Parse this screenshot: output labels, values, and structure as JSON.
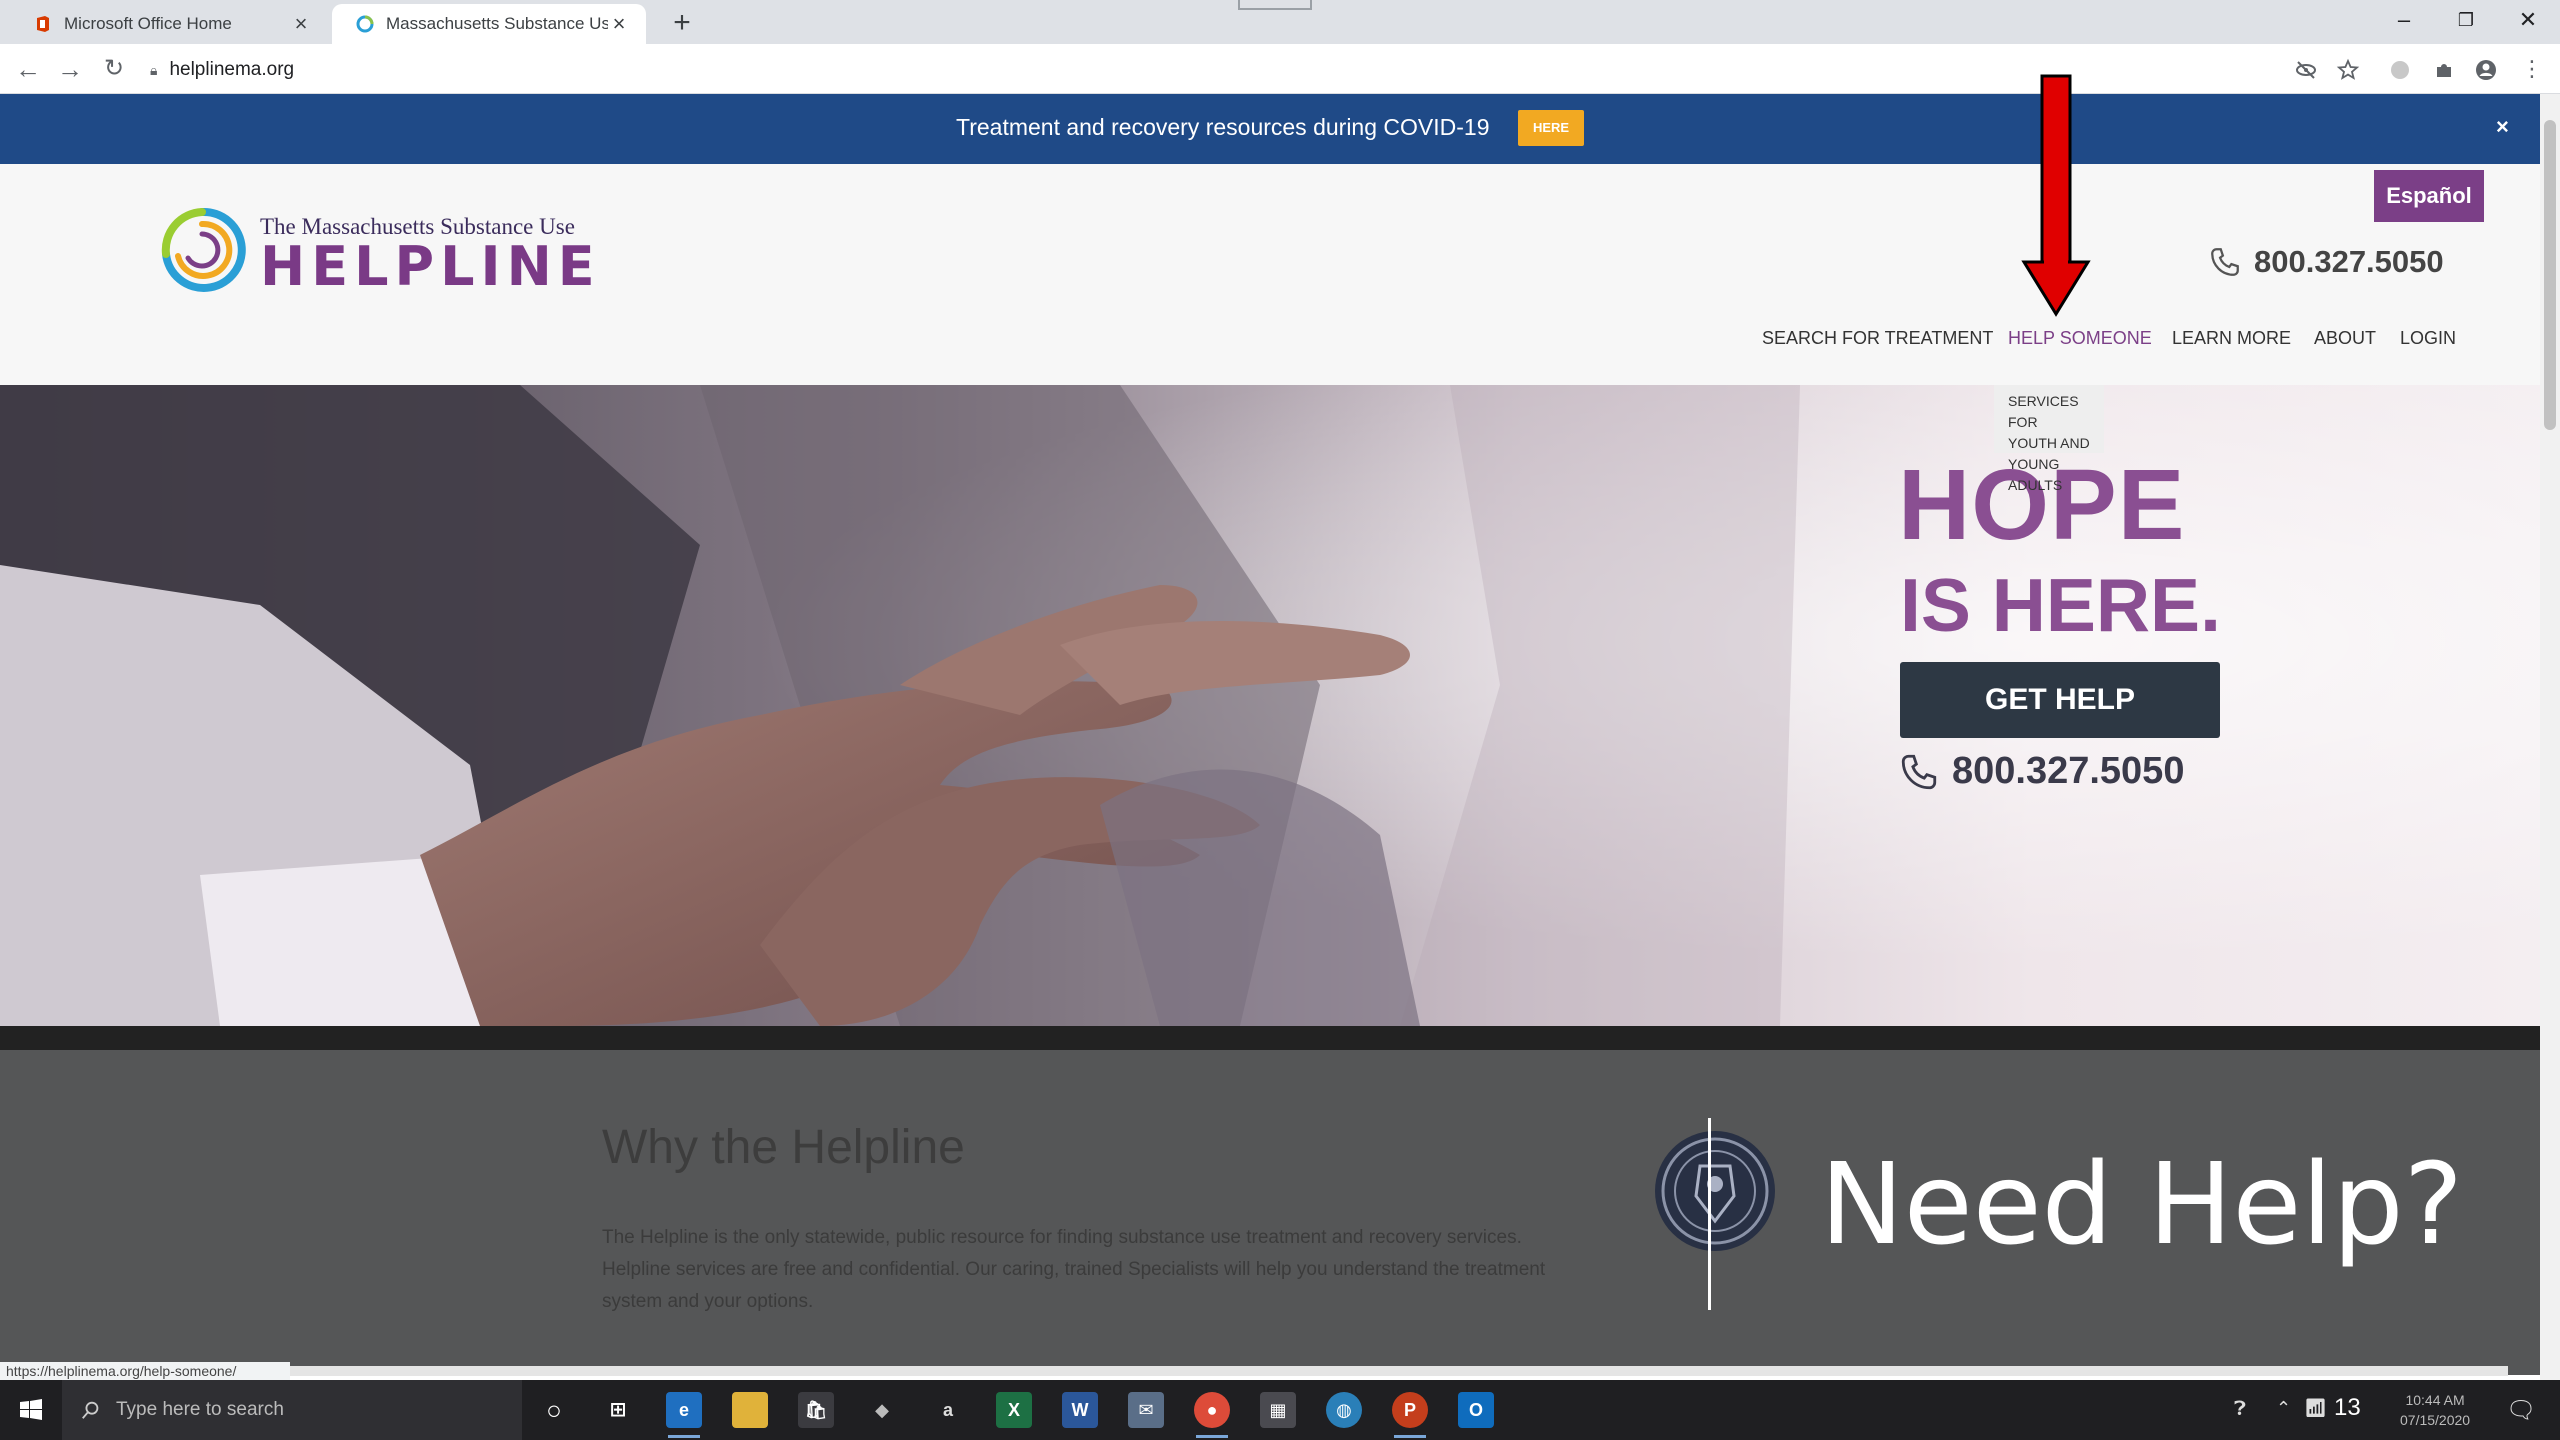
{
  "browser": {
    "tabs": [
      {
        "title": "Microsoft Office Home",
        "active": false,
        "favicon": "office-icon"
      },
      {
        "title": "Massachusetts Substance Use He",
        "active": true,
        "favicon": "helpline-icon"
      }
    ],
    "url": "helplinema.org",
    "status_url": "https://helplinema.org/help-someone/"
  },
  "banner": {
    "text": "Treatment and recovery resources during COVID-19",
    "button": "HERE",
    "close": "×"
  },
  "header": {
    "logo_small": "The Massachusetts Substance Use",
    "logo_big": "HELPLINE",
    "espanol": "Español",
    "phone": "800.327.5050"
  },
  "nav": {
    "items": [
      "SEARCH FOR TREATMENT",
      "HELP SOMEONE",
      "LEARN MORE",
      "ABOUT",
      "LOGIN"
    ],
    "submenu": [
      "SERVICES FOR",
      "YOUTH AND",
      "YOUNG ADULTS"
    ]
  },
  "hero": {
    "headline_1": "HOPE",
    "headline_2": "IS HERE.",
    "button": "GET HELP",
    "phone": "800.327.5050"
  },
  "why": {
    "title": "Why the Helpline",
    "body": "The Helpline is the only statewide, public resource for finding substance use treatment and recovery services. Helpline services are free and confidential. Our caring, trained Specialists will help you understand the treatment system and your options."
  },
  "slide": {
    "title": "Need Help?",
    "number": "13"
  },
  "taskbar": {
    "search_placeholder": "Type here to search",
    "time": "10:44 AM",
    "date": "07/15/2020"
  },
  "colors": {
    "banner": "#1f4a87",
    "accent_purple": "#7b3f87",
    "here_button": "#f2a922",
    "get_help_button": "#2d3844",
    "arrow": "#e00000"
  }
}
